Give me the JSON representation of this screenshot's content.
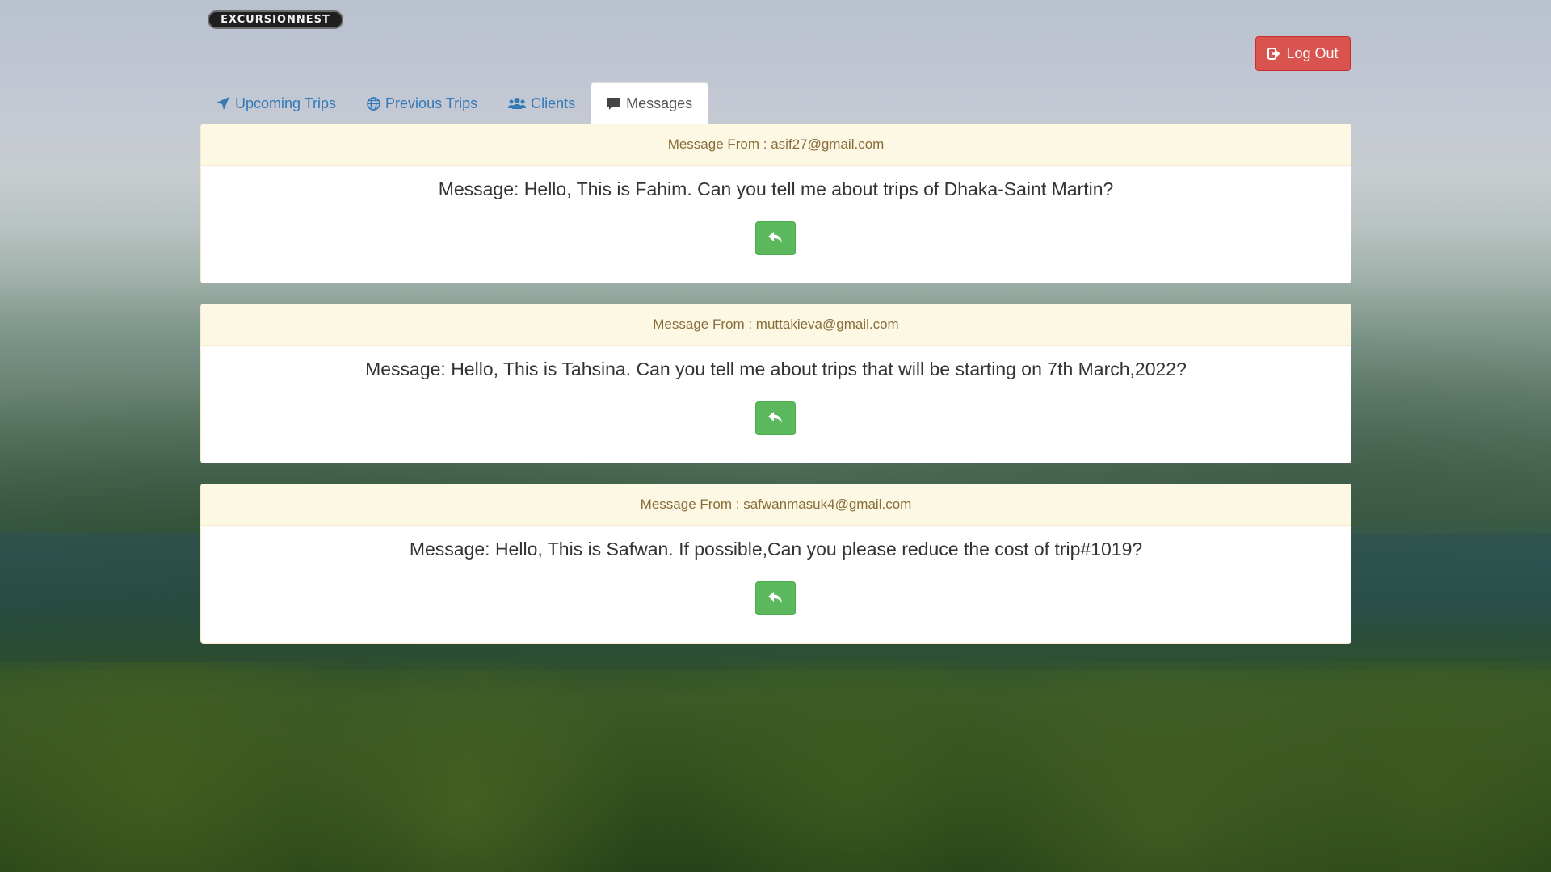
{
  "brand": {
    "logo_text": "EXCURSIONNEST"
  },
  "header": {
    "logout_label": "Log Out"
  },
  "tabs": [
    {
      "label": "Upcoming Trips",
      "icon": "paper-plane-icon",
      "active": false
    },
    {
      "label": "Previous Trips",
      "icon": "globe-icon",
      "active": false
    },
    {
      "label": "Clients",
      "icon": "users-icon",
      "active": false
    },
    {
      "label": "Messages",
      "icon": "comment-icon",
      "active": true
    }
  ],
  "messages": [
    {
      "from": "Message From : asif27@gmail.com",
      "text": "Message: Hello, This is Fahim. Can you tell me about trips of Dhaka-Saint Martin?"
    },
    {
      "from": "Message From : muttakieva@gmail.com",
      "text": "Message: Hello, This is Tahsina. Can you tell me about trips that will be starting on 7th March,2022?"
    },
    {
      "from": "Message From : safwanmasuk4@gmail.com",
      "text": "Message: Hello, This is Safwan. If possible,Can you please reduce the cost of trip#1019?"
    }
  ],
  "colors": {
    "link": "#337ab7",
    "danger": "#d9534f",
    "success": "#5cb85c",
    "panel_heading_bg": "#fcf8e3",
    "panel_heading_text": "#8a6d3b"
  }
}
